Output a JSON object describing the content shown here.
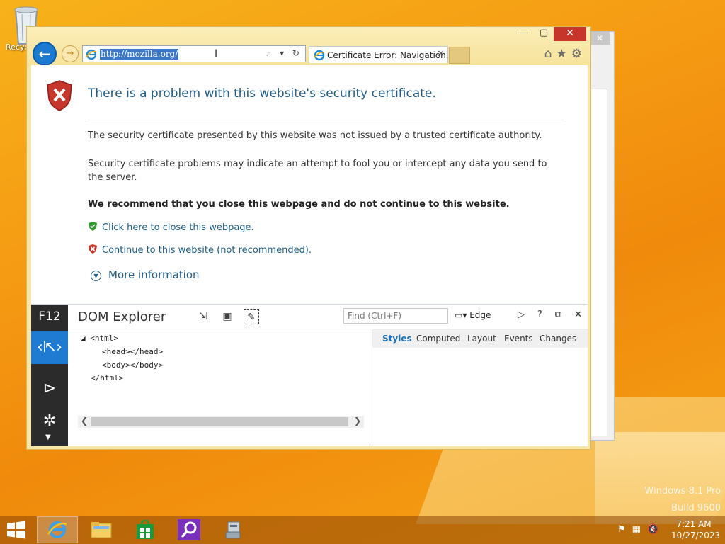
{
  "desktop": {
    "recycle_label": "Recyc",
    "watermark_line1": "Windows 8.1 Pro",
    "watermark_line2": "Build 9600"
  },
  "browser": {
    "window_buttons": {
      "minimize": "—",
      "maximize": "▢",
      "close": "✕"
    },
    "address_url": "http://mozilla.org/",
    "address_tools": "⌕ ▾ ↻",
    "tab_title": "Certificate Error: Navigation...",
    "tab_close": "✕",
    "toolbar_icons": [
      "home-icon",
      "favorites-star-icon",
      "settings-gear-icon"
    ]
  },
  "page": {
    "headline": "There is a problem with this website's security certificate.",
    "para1": "The security certificate presented by this website was not issued by a trusted certificate authority.",
    "para2": "Security certificate problems may indicate an attempt to fool you or intercept any data you send to the server.",
    "recommend": "We recommend that you close this webpage and do not continue to this website.",
    "link_close": "Click here to close this webpage.",
    "link_continue": "Continue to this website (not recommended).",
    "more_info": "More information"
  },
  "devtools": {
    "f12": "F12",
    "panel_title": "DOM Explorer",
    "find_placeholder": "Find (Ctrl+F)",
    "mode": "Edge",
    "help": "?",
    "dom_lines": [
      "◢ <html>",
      "<head></head>",
      "<body></body>",
      "</html>"
    ],
    "style_tabs": [
      "Styles",
      "Computed",
      "Layout",
      "Events",
      "Changes"
    ],
    "active_style_tab": "Styles"
  },
  "taskbar": {
    "apps": [
      "internet-explorer",
      "file-explorer",
      "store",
      "search",
      "desktop-app"
    ],
    "time": "7:21 AM",
    "date": "10/27/2023"
  },
  "colors": {
    "accent": "#1e7bd1",
    "link": "#1a5e8a",
    "headline": "#1f5d86",
    "window_frame": "#f6e6a8",
    "error_red": "#c7362b"
  }
}
